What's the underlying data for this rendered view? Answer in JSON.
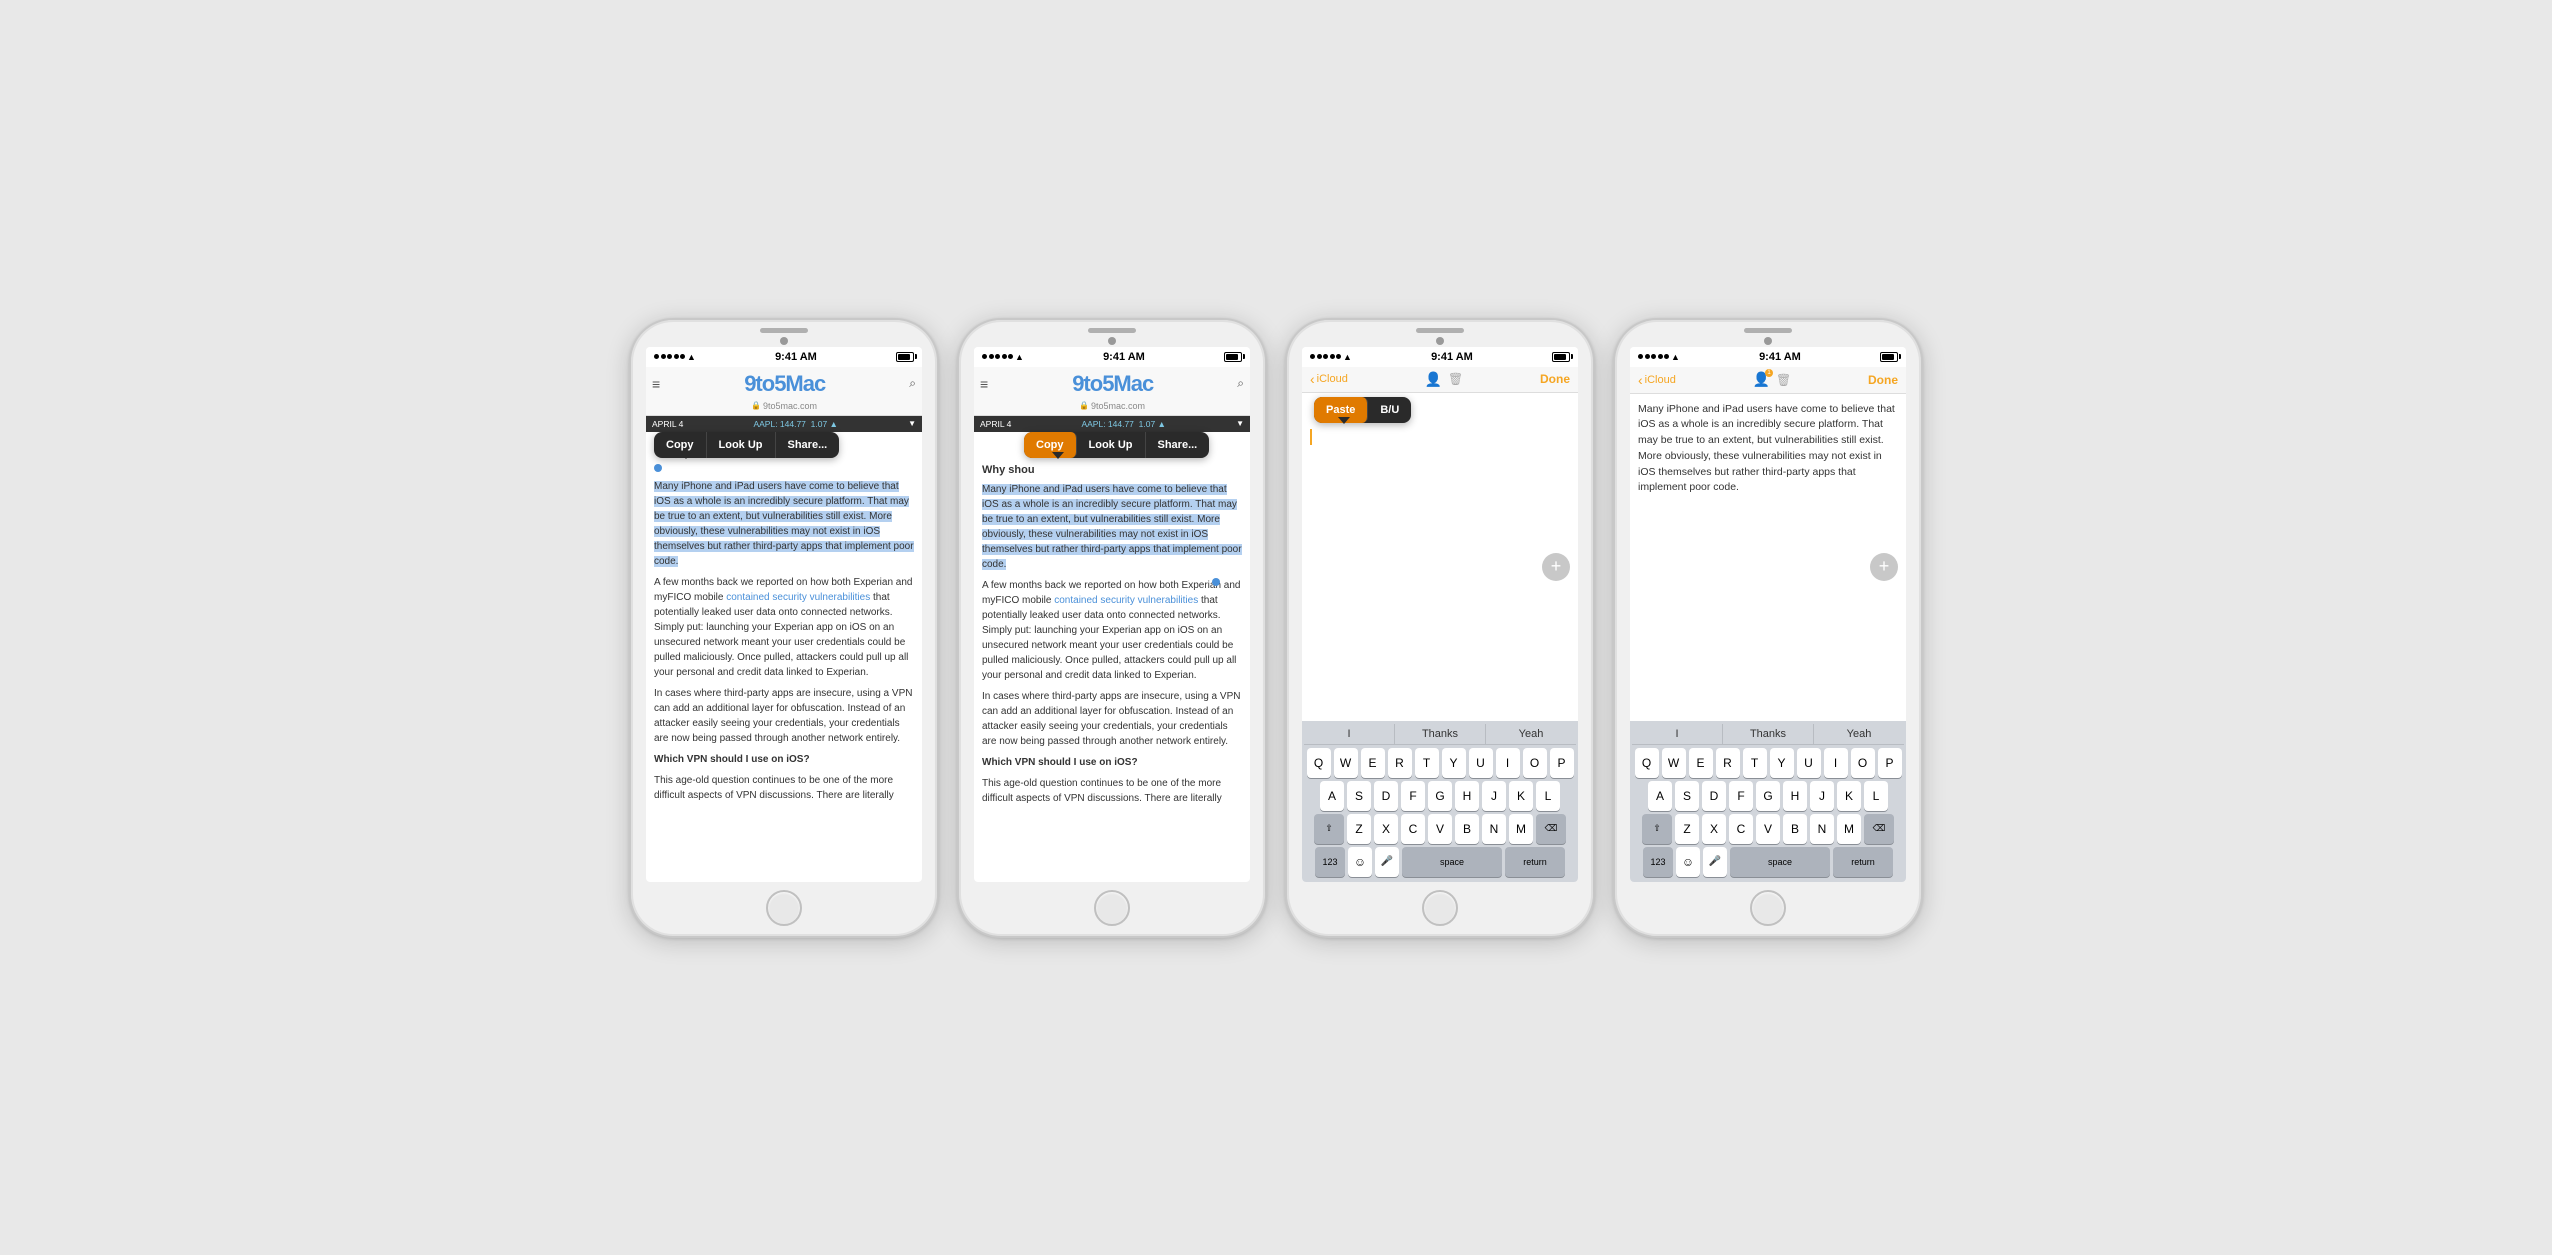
{
  "phones": [
    {
      "id": "phone1",
      "type": "browser",
      "status": {
        "signal_dots": 5,
        "wifi": "wifi",
        "time": "9:41 AM",
        "battery": "full"
      },
      "address": "9to5mac.com",
      "logo": "9to5Mac",
      "ticker": {
        "date": "APRIL 4",
        "stock": "AAPL: 144.77",
        "change": "1.07",
        "direction": "▲"
      },
      "context_menu": {
        "items": [
          "Copy",
          "Look Up",
          "Share..."
        ],
        "highlighted": null
      },
      "article": {
        "paragraphs": [
          "Many iPhone and iPad users have come to believe that iOS as a whole is an incredibly secure platform. That may be true to an extent, but vulnerabilities still exist. More obviously, these vulnerabilities may not exist in iOS themselves but rather third-party apps that implement poor code.",
          "A few months back we reported on how both Experian and myFICO mobile contained security vulnerabilities that potentially leaked user data onto connected networks. Simply put: launching your Experian app on iOS on an unsecured network meant your user credentials could be pulled maliciously. Once pulled, attackers could pull up all your personal and credit data linked to Experian.",
          "In cases where third-party apps are insecure, using a VPN can add an additional layer for obfuscation. Instead of an attacker easily seeing your credentials, your credentials are now being passed through another network entirely.",
          "Which VPN should I use on iOS?",
          "This age-old question continues to be one of the more difficult aspects of VPN discussions. There are literally"
        ],
        "link_text": "contained security vulnerabilities",
        "bold_paragraph": "Which VPN should I use on iOS?"
      }
    },
    {
      "id": "phone2",
      "type": "browser",
      "status": {
        "signal_dots": 5,
        "wifi": "wifi",
        "time": "9:41 AM",
        "battery": "full"
      },
      "address": "9to5mac.com",
      "logo": "9to5Mac",
      "ticker": {
        "date": "APRIL 4",
        "stock": "AAPL: 144.77",
        "change": "1.07",
        "direction": "▲"
      },
      "context_menu": {
        "items": [
          "Copy",
          "Look Up",
          "Share..."
        ],
        "highlighted": "Copy"
      },
      "article_title": "Why shou",
      "article": {
        "paragraphs": [
          "Many iPhone and iPad users have come to believe that iOS as a whole is an incredibly secure platform. That may be true to an extent, but vulnerabilities still exist. More obviously, these vulnerabilities may not exist in iOS themselves but rather third-party apps that implement poor code.",
          "A few months back we reported on how both Experian and myFICO mobile contained security vulnerabilities that potentially leaked user data onto connected networks. Simply put: launching your Experian app on iOS on an unsecured network meant your user credentials could be pulled maliciously. Once pulled, attackers could pull up all your personal and credit data linked to Experian.",
          "In cases where third-party apps are insecure, using a VPN can add an additional layer for obfuscation. Instead of an attacker easily seeing your credentials, your credentials are now being passed through another network entirely.",
          "Which VPN should I use on iOS?",
          "This age-old question continues to be one of the more difficult aspects of VPN discussions. There are literally"
        ],
        "link_text": "contained security vulnerabilities",
        "bold_paragraph": "Which VPN should I use on iOS?"
      }
    },
    {
      "id": "phone3",
      "type": "notes",
      "status": {
        "signal_dots": 5,
        "wifi": "wifi",
        "time": "9:41 AM",
        "battery": "full"
      },
      "header": {
        "back_text": "iCloud",
        "done_text": "Done"
      },
      "paste_menu": {
        "items": [
          "Paste",
          "B/U"
        ],
        "highlighted": "Paste"
      },
      "content": "",
      "keyboard": {
        "suggestions": [
          "I",
          "Thanks",
          "Yeah"
        ],
        "rows": [
          [
            "Q",
            "W",
            "E",
            "R",
            "T",
            "Y",
            "U",
            "I",
            "O",
            "P"
          ],
          [
            "A",
            "S",
            "D",
            "F",
            "G",
            "H",
            "J",
            "K",
            "L"
          ],
          [
            "⇧",
            "Z",
            "X",
            "C",
            "V",
            "B",
            "N",
            "M",
            "⌫"
          ],
          [
            "123",
            "☺",
            "🎤",
            "space",
            "return"
          ]
        ]
      }
    },
    {
      "id": "phone4",
      "type": "notes",
      "status": {
        "signal_dots": 5,
        "wifi": "wifi",
        "time": "9:41 AM",
        "battery": "full"
      },
      "header": {
        "back_text": "iCloud",
        "done_text": "Done"
      },
      "content": "Many iPhone and iPad users have come to believe that iOS as a whole is an incredibly secure platform. That may be true to an extent, but vulnerabilities still exist. More obviously, these vulnerabilities may not exist in iOS themselves but rather third-party apps that implement poor code.",
      "keyboard": {
        "suggestions": [
          "I",
          "Thanks",
          "Yeah"
        ],
        "rows": [
          [
            "Q",
            "W",
            "E",
            "R",
            "T",
            "Y",
            "U",
            "I",
            "O",
            "P"
          ],
          [
            "A",
            "S",
            "D",
            "F",
            "G",
            "H",
            "J",
            "K",
            "L"
          ],
          [
            "⇧",
            "Z",
            "X",
            "C",
            "V",
            "B",
            "N",
            "M",
            "⌫"
          ],
          [
            "123",
            "☺",
            "🎤",
            "space",
            "return"
          ]
        ]
      }
    }
  ]
}
